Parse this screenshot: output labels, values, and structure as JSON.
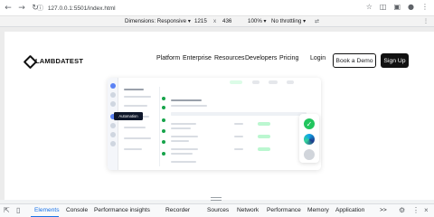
{
  "browser": {
    "url": "127.0.0.1:5501/index.html",
    "back_icon": "arrow-left-icon",
    "forward_icon": "arrow-right-icon",
    "reload_icon": "reload-icon",
    "bookmark_icon": "star-icon"
  },
  "device_toolbar": {
    "dimensions_label": "Dimensions: Responsive",
    "width": "1215",
    "times": "x",
    "height": "436",
    "zoom": "100%",
    "throttling": "No throttling"
  },
  "site": {
    "brand": "LAMBDATEST",
    "nav": [
      "Platform",
      "Enterprise",
      "Resources",
      "Developers",
      "Pricing"
    ],
    "login": "Login",
    "book_demo": "Book a Demo",
    "sign_up": "Sign Up",
    "tooltip": "Automation"
  },
  "devtools": {
    "tabs": [
      "Elements",
      "Console",
      "Performance insights",
      "Recorder",
      "Sources",
      "Network",
      "Performance",
      "Memory",
      "Application"
    ],
    "active_tab": "Elements",
    "more": ">>"
  }
}
